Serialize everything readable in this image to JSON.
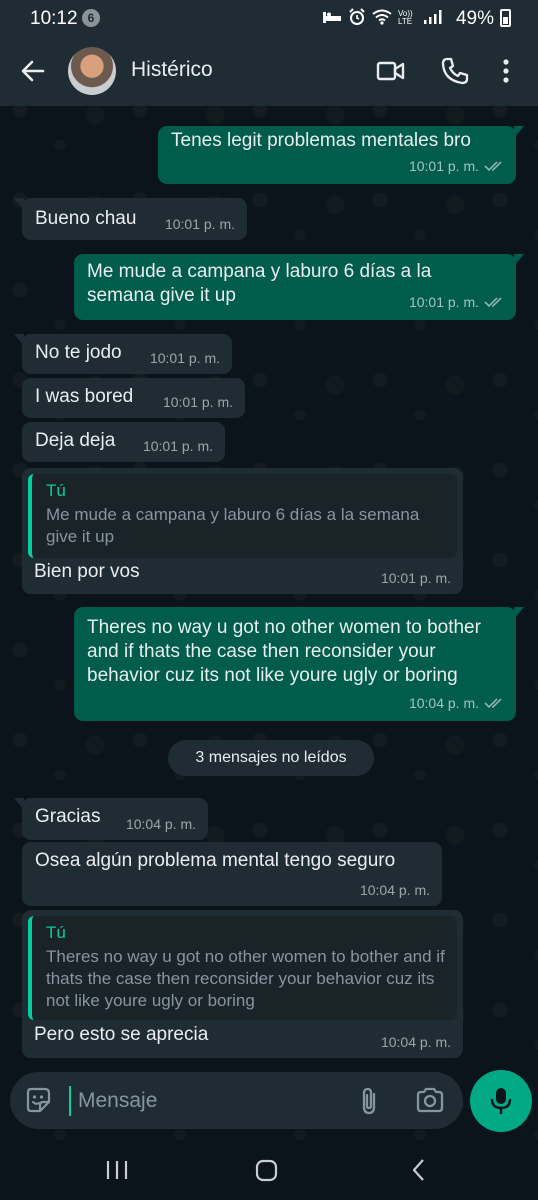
{
  "status_bar": {
    "time": "10:12",
    "notification_count": "6",
    "battery_percent": "49%",
    "icons": [
      "sleep-icon",
      "alarm-icon",
      "wifi-icon",
      "volte-icon",
      "signal-icon",
      "battery-icon"
    ],
    "volte_label": "Vo)) LTE"
  },
  "header": {
    "contact_name": "Histérico",
    "icons": [
      "back-arrow-icon",
      "video-call-icon",
      "phone-icon",
      "more-options-icon"
    ]
  },
  "messages": [
    {
      "direction": "out",
      "text": "Tenes legit problemas mentales bro",
      "time": "10:01 p. m.",
      "status": "read"
    },
    {
      "direction": "in",
      "text": "Bueno chau",
      "time": "10:01 p. m."
    },
    {
      "direction": "out",
      "text": "Me mude a campana y laburo 6 días a la semana give it up",
      "time": "10:01 p. m.",
      "status": "read"
    },
    {
      "direction": "in",
      "text": "No te jodo",
      "time": "10:01 p. m."
    },
    {
      "direction": "in",
      "text": "I was bored",
      "time": "10:01 p. m."
    },
    {
      "direction": "in",
      "text": "Deja deja",
      "time": "10:01 p. m."
    },
    {
      "direction": "in",
      "reply_to_author": "Tú",
      "reply_to_text": "Me mude a campana y laburo 6 días a la semana give it up",
      "text": "Bien por vos",
      "time": "10:01 p. m."
    },
    {
      "direction": "out",
      "text": "Theres no way u got no other women to bother and if thats the case then reconsider your behavior cuz its not like youre ugly or boring",
      "time": "10:04 p. m.",
      "status": "read"
    },
    {
      "direction": "in",
      "text": "Gracias",
      "time": "10:04 p. m."
    },
    {
      "direction": "in",
      "text": "Osea algún problema mental tengo seguro",
      "time": "10:04 p. m."
    },
    {
      "direction": "in",
      "reply_to_author": "Tú",
      "reply_to_text": "Theres no way u got no other women to bother and if thats the case then reconsider your behavior cuz its not like youre ugly or boring",
      "text": "Pero esto se aprecia",
      "time": "10:04 p. m."
    }
  ],
  "unread_divider": "3 mensajes no leídos",
  "composer": {
    "placeholder": "Mensaje",
    "icons": [
      "emoji-sticker-icon",
      "attach-icon",
      "camera-icon",
      "mic-icon"
    ]
  },
  "colors": {
    "background": "#0b141a",
    "header": "#1f2c33",
    "incoming_bubble": "#202c33",
    "outgoing_bubble": "#005c4b",
    "accent": "#00a884",
    "quote_accent": "#06cf9c"
  }
}
